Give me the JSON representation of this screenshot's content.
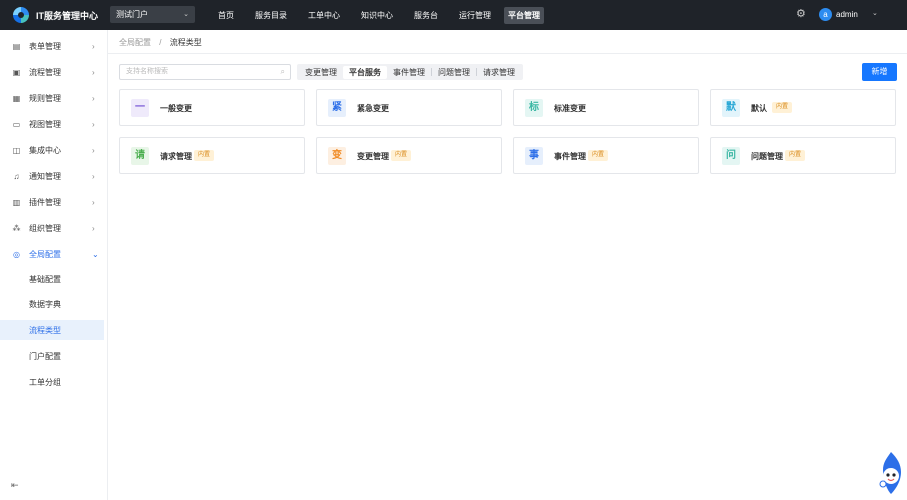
{
  "header": {
    "app_title": "IT服务管理中心",
    "portal": "测试门户",
    "nav": [
      "首页",
      "服务目录",
      "工单中心",
      "知识中心",
      "服务台",
      "运行管理",
      "平台管理"
    ],
    "active_nav": "平台管理",
    "user_initial": "a",
    "username": "admin"
  },
  "sidebar": {
    "items": [
      {
        "label": "表单管理",
        "icon": "form-icon"
      },
      {
        "label": "流程管理",
        "icon": "process-icon"
      },
      {
        "label": "规则管理",
        "icon": "rule-icon"
      },
      {
        "label": "视图管理",
        "icon": "view-icon"
      },
      {
        "label": "集成中心",
        "icon": "integration-icon"
      },
      {
        "label": "通知管理",
        "icon": "bell-icon"
      },
      {
        "label": "插件管理",
        "icon": "plugin-icon"
      },
      {
        "label": "组织管理",
        "icon": "org-icon"
      },
      {
        "label": "全局配置",
        "icon": "settings-icon"
      }
    ],
    "sub_items": [
      "基础配置",
      "数据字典",
      "流程类型",
      "门户配置",
      "工单分组"
    ],
    "active_sub": "流程类型"
  },
  "breadcrumb": {
    "parent": "全局配置",
    "separator": "/",
    "current": "流程类型"
  },
  "search": {
    "placeholder": "支持名称搜索"
  },
  "tabs": [
    "变更管理",
    "平台服务",
    "事件管理",
    "问题管理",
    "请求管理"
  ],
  "active_tab": "平台服务",
  "new_button": "新增",
  "cards": [
    {
      "char": "一",
      "name": "一般变更",
      "badge": "",
      "color": "#7b5bd6",
      "bg": "#efeafb"
    },
    {
      "char": "紧",
      "name": "紧急变更",
      "badge": "",
      "color": "#2d6fe8",
      "bg": "#e6effc"
    },
    {
      "char": "标",
      "name": "标准变更",
      "badge": "",
      "color": "#3bb7a4",
      "bg": "#e4f6f3"
    },
    {
      "char": "默",
      "name": "默认",
      "badge": "内置",
      "color": "#29a8d6",
      "bg": "#e2f4fb"
    },
    {
      "char": "请",
      "name": "请求管理",
      "badge": "内置",
      "color": "#4caf50",
      "bg": "#e8f6e8"
    },
    {
      "char": "变",
      "name": "变更管理",
      "badge": "内置",
      "color": "#f08a24",
      "bg": "#fdefe1"
    },
    {
      "char": "事",
      "name": "事件管理",
      "badge": "内置",
      "color": "#2d6fe8",
      "bg": "#e6effc"
    },
    {
      "char": "问",
      "name": "问题管理",
      "badge": "内置",
      "color": "#3bb7a4",
      "bg": "#e4f6f3"
    }
  ]
}
